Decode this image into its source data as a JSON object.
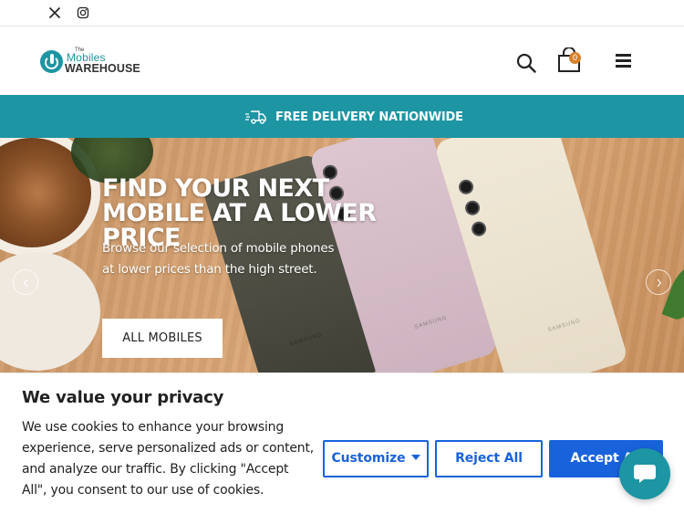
{
  "social": {
    "icons": [
      "x-icon",
      "instagram-icon"
    ]
  },
  "header": {
    "logo": {
      "the": "The",
      "mobiles": "Mobiles",
      "warehouse": "WAREHOUSE"
    },
    "cart_count": "0"
  },
  "delivery": {
    "text": "FREE DELIVERY NATIONWIDE"
  },
  "hero": {
    "title": "FIND YOUR NEXT MOBILE AT A LOWER PRICE",
    "subtitle": "Browse our selection of mobile phones at lower prices than the high street.",
    "button": "ALL MOBILES",
    "phone_brand": "SAMSUNG"
  },
  "cookie": {
    "title": "We value your privacy",
    "text": "We use cookies to enhance your browsing experience, serve personalized ads or content, and analyze our traffic. By clicking \"Accept All\", you consent to our use of cookies.",
    "customize": "Customize",
    "reject": "Reject All",
    "accept": "Accept All"
  },
  "colors": {
    "brand": "#1d95a3",
    "accent": "#1863dc",
    "badge": "#d7802a"
  }
}
